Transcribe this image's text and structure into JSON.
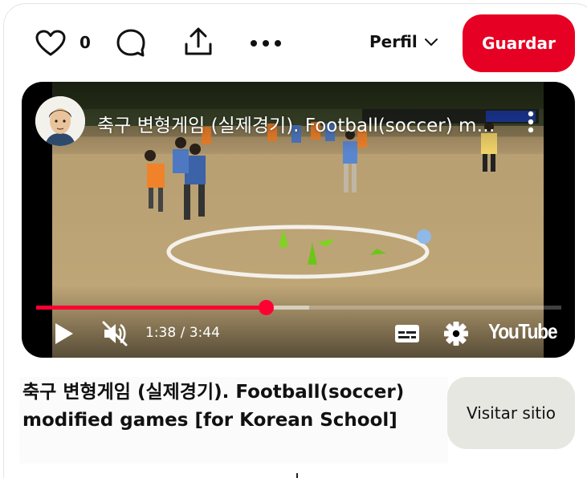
{
  "topbar": {
    "like_icon": "heart-icon",
    "like_count": "0",
    "comment_icon": "comment-bubble-icon",
    "share_icon": "share-upload-icon",
    "more_icon": "more-horizontal-icon",
    "profile_label": "Perfil",
    "profile_icon": "chevron-down-icon",
    "save_label": "Guardar",
    "save_color": "#e60023"
  },
  "video": {
    "title": "축구 변형게임 (실제경기). Football(soccer) modified games [for Korean School]",
    "channel_avatar": "cartoon-man-avatar",
    "current_time": "1:38",
    "duration": "3:44",
    "time_display": "1:38 / 3:44",
    "progress_fraction": 0.437,
    "buffered_fraction": 0.52,
    "progress_color": "#ff0033",
    "logo": "YouTube",
    "controls": {
      "play_icon": "play-icon",
      "mute_icon": "muted-speaker-icon",
      "captions_icon": "closed-captions-icon",
      "settings_icon": "gear-icon",
      "menu_icon": "more-vertical-icon"
    }
  },
  "pin": {
    "title": "축구 변형게임 (실제경기). Football(soccer) modified games [for Korean School]",
    "visit_label": "Visitar sitio"
  }
}
